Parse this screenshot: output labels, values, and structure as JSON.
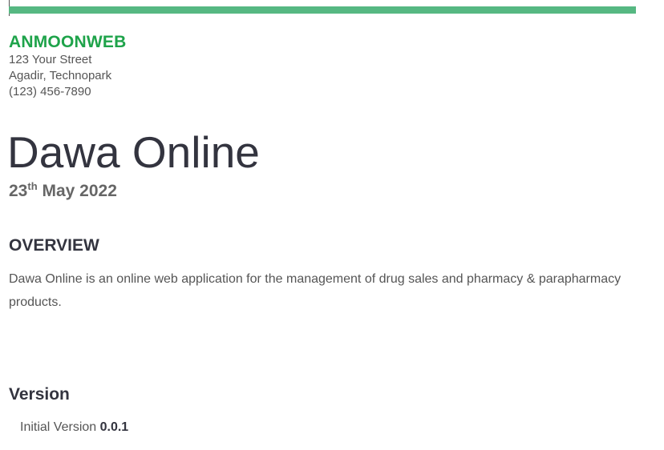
{
  "company": {
    "name": "ANMOONWEB",
    "street": "123 Your Street",
    "city": "Agadir, Technopark",
    "phone": "(123) 456-7890"
  },
  "document": {
    "title": "Dawa Online",
    "date_day": "23",
    "date_suffix": "th",
    "date_rest": " May 2022"
  },
  "overview": {
    "heading": "OVERVIEW",
    "text": "Dawa Online  is an online web application  for the management of drug sales and pharmacy & parapharmacy products."
  },
  "version": {
    "heading": "Version",
    "label": "Initial Version ",
    "number": "0.0.1"
  },
  "colors": {
    "accent_bar": "#56b882",
    "company_name": "#1ea34a",
    "heading": "#33343f"
  }
}
